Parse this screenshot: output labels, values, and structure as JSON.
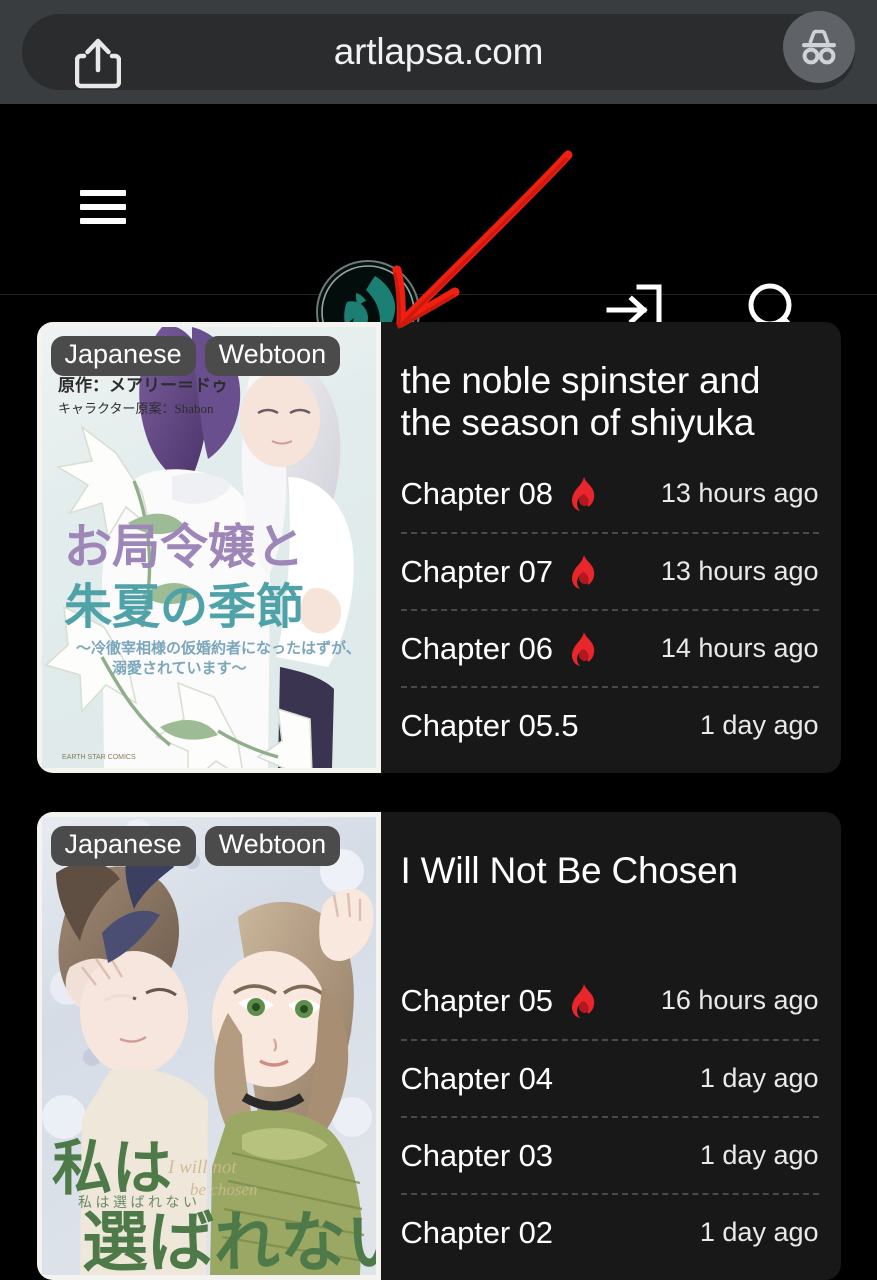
{
  "browser": {
    "url": "artlapsa.com",
    "share_icon": "share-icon",
    "incognito_icon": "incognito-icon"
  },
  "site_header": {
    "menu_icon": "hamburger-menu-icon",
    "logo_icon": "site-logo-icon",
    "login_icon": "login-icon",
    "search_icon": "search-icon"
  },
  "annotation": {
    "type": "hand-drawn-arrow",
    "color": "#f01f10"
  },
  "colors": {
    "page_background": "#000000",
    "card_background": "#181818",
    "badge_background": "#4b4b4b",
    "flame": "#e8262c",
    "accent_logo": "#1d7a6f",
    "text_primary": "#ffffff"
  },
  "cards": [
    {
      "title": "the noble spinster and the season of shiyuka",
      "badges": [
        "Japanese",
        "Webtoon"
      ],
      "cover_alt": "manga cover with purple-haired and silver-haired characters among white lilies",
      "chapters": [
        {
          "name": "Chapter 08",
          "time": "13 hours ago",
          "hot": true
        },
        {
          "name": "Chapter 07",
          "time": "13 hours ago",
          "hot": true
        },
        {
          "name": "Chapter 06",
          "time": "14 hours ago",
          "hot": true
        },
        {
          "name": "Chapter 05.5",
          "time": "1 day ago",
          "hot": false
        }
      ]
    },
    {
      "title": "I Will Not Be Chosen",
      "badges": [
        "Japanese",
        "Webtoon"
      ],
      "cover_alt": "manga cover with two characters lying among pale flowers",
      "chapters": [
        {
          "name": "Chapter 05",
          "time": "16 hours ago",
          "hot": true
        },
        {
          "name": "Chapter 04",
          "time": "1 day ago",
          "hot": false
        },
        {
          "name": "Chapter 03",
          "time": "1 day ago",
          "hot": false
        },
        {
          "name": "Chapter 02",
          "time": "1 day ago",
          "hot": false
        }
      ]
    }
  ]
}
